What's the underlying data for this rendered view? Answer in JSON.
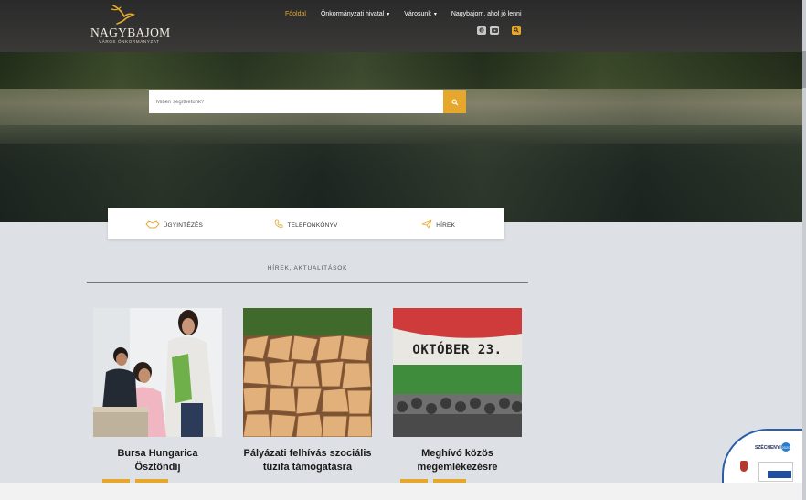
{
  "header": {
    "logo_name": "NAGYBAJOM",
    "logo_sub": "VÁROS ÖNKORMÁNYZAT",
    "nav": [
      {
        "label": "Főoldal",
        "active": true,
        "dropdown": false
      },
      {
        "label": "Önkormányzati hivatal",
        "active": false,
        "dropdown": true
      },
      {
        "label": "Városunk",
        "active": false,
        "dropdown": true
      },
      {
        "label": "Nagybajom, ahol jó lenni",
        "active": false,
        "dropdown": false
      }
    ],
    "social_icons": [
      "facebook-icon",
      "youtube-icon"
    ],
    "search_icon": "search-icon"
  },
  "hero": {
    "search_placeholder": "Miben segíthetünk?"
  },
  "quick_links": [
    {
      "label": "ÜGYINTÉZÉS",
      "icon": "handshake-icon"
    },
    {
      "label": "TELEFONKÖNYV",
      "icon": "phone-icon"
    },
    {
      "label": "HÍREK",
      "icon": "paper-plane-icon"
    }
  ],
  "news": {
    "section_title": "HÍREK, AKTUALITÁSOK",
    "cards": [
      {
        "title": "Bursa Hungarica Ösztöndíj"
      },
      {
        "title": "Pályázati felhívás szociális tűzifa támogatásra"
      },
      {
        "title": "Meghívó közös megemlékezésre",
        "image_text": "OKTÓBER 23."
      }
    ]
  },
  "badge": {
    "title": "SZÉCHENYI",
    "dot": "2020"
  },
  "colors": {
    "accent": "#e5a82c",
    "header_bg": "#2f2f2f",
    "page_bg": "#dde1e5"
  }
}
